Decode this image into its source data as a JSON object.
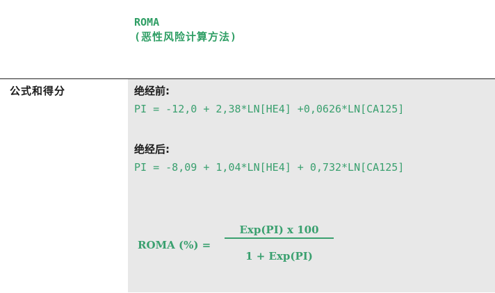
{
  "title": {
    "name": "ROMA",
    "subtitle": "(恶性风险计算方法)"
  },
  "row": {
    "label": "公式和得分",
    "premenopausal": {
      "heading": "绝经前:",
      "formula": "PI = -12,0 + 2,38*LN[HE4] +0,0626*LN[CA125]"
    },
    "postmenopausal": {
      "heading": "绝经后:",
      "formula": "PI = -8,09 + 1,04*LN[HE4] + 0,732*LN[CA125]"
    },
    "roma_equation": {
      "lhs": "ROMA (%) =",
      "numerator": "Exp(PI) x 100",
      "denominator": "1 + Exp(PI)"
    }
  },
  "colors": {
    "formula_green": "#3aa06f",
    "title_green": "#2e9e64",
    "cell_background": "#e8e8e8"
  }
}
